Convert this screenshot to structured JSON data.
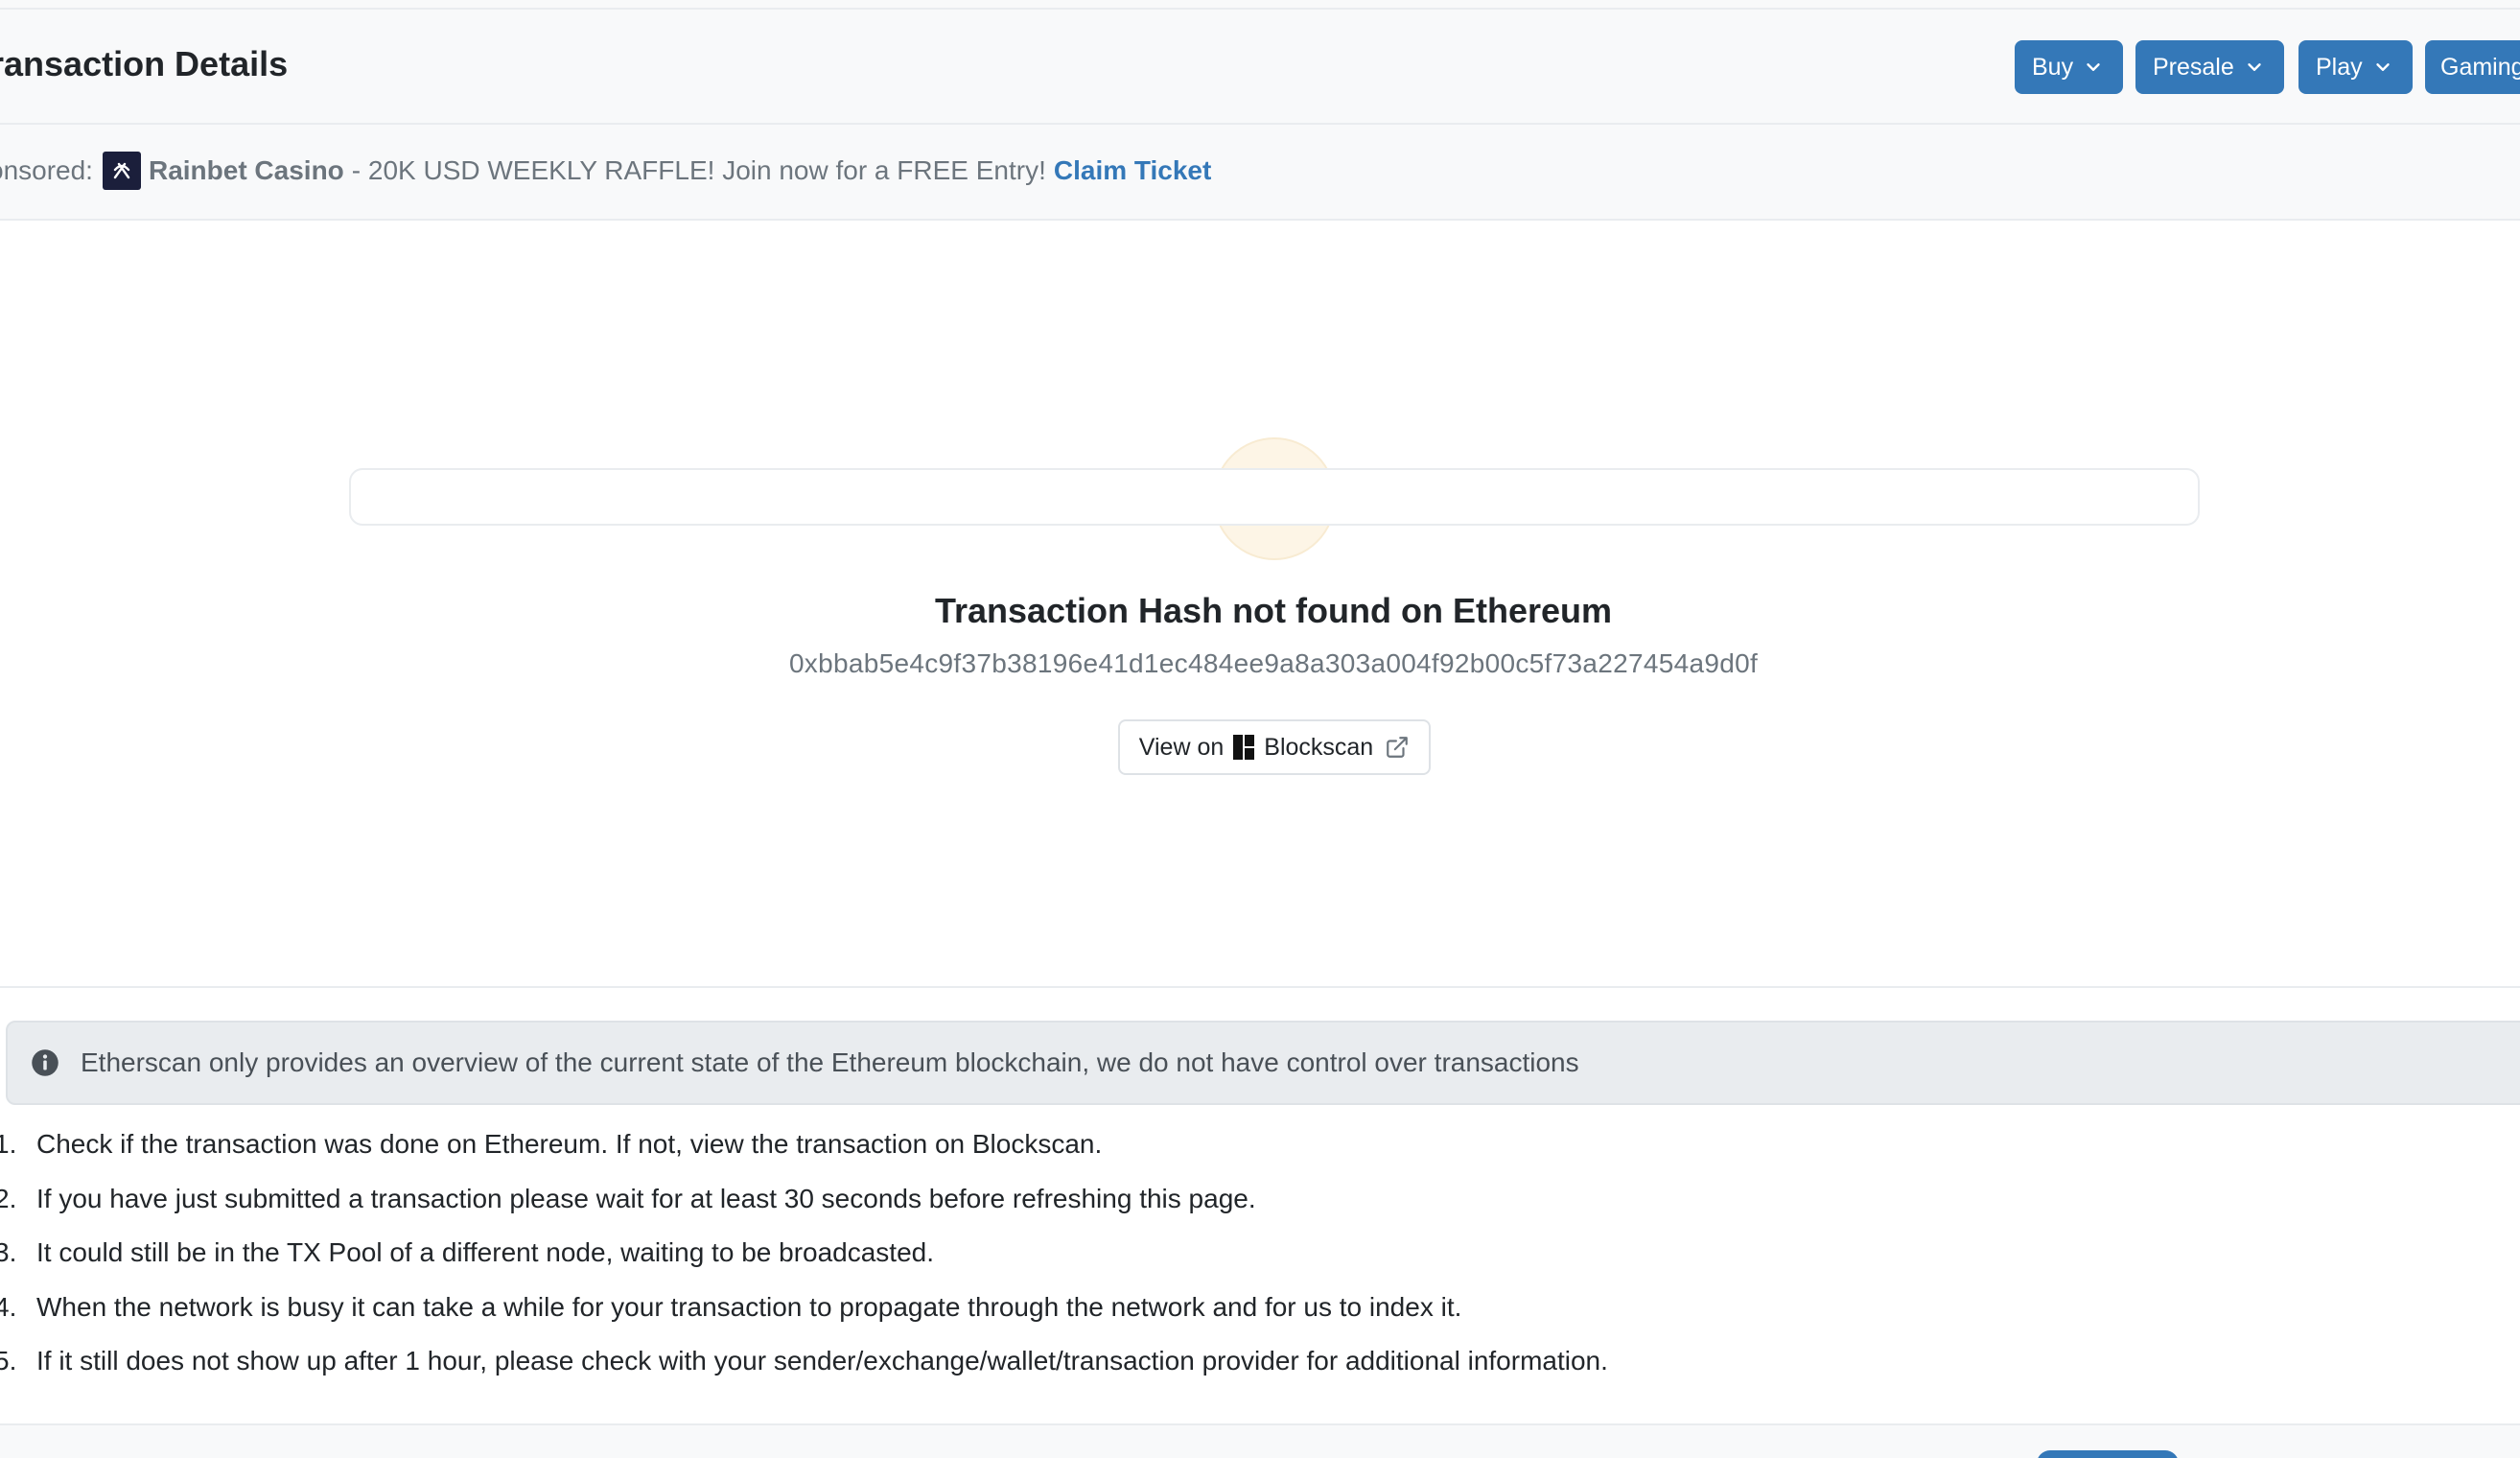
{
  "header": {
    "title": "ransaction Details",
    "nav": [
      {
        "label": "Buy"
      },
      {
        "label": "Presale"
      },
      {
        "label": "Play"
      },
      {
        "label": "Gaming"
      }
    ]
  },
  "sponsor": {
    "prefix": "onsored:",
    "name": "Rainbet Casino",
    "message": "- 20K USD WEEKLY RAFFLE! Join now for a FREE Entry!",
    "cta": "Claim Ticket"
  },
  "not_found": {
    "icon": "file-off-icon",
    "title": "Transaction Hash not found on Ethereum",
    "hash": "0xbbab5e4c9f37b38196e41d1ec484ee9a8a303a004f92b00c5f73a227454a9d0f",
    "view_prefix": "View on",
    "view_site": "Blockscan"
  },
  "info": {
    "icon": "info-circle-icon",
    "text": "Etherscan only provides an overview of the current state of the Ethereum blockchain, we do not have control over transactions"
  },
  "steps": [
    {
      "num": "1.",
      "text": "Check if the transaction was done on Ethereum. If not, view the transaction on Blockscan."
    },
    {
      "num": "2.",
      "text": "If you have just submitted a transaction please wait for at least 30 seconds before refreshing this page."
    },
    {
      "num": "3.",
      "text": "It could still be in the TX Pool of a different node, waiting to be broadcasted."
    },
    {
      "num": "4.",
      "text": "When the network is busy it can take a while for your transaction to propagate through the network and for us to index it."
    },
    {
      "num": "5.",
      "text": "If it still does not show up after 1 hour, please check with your sender/exchange/wallet/transaction provider for additional information."
    }
  ],
  "colors": {
    "accent": "#3478b8",
    "warning_bg": "#fdf5e6",
    "warning_icon": "#c99a2e"
  }
}
